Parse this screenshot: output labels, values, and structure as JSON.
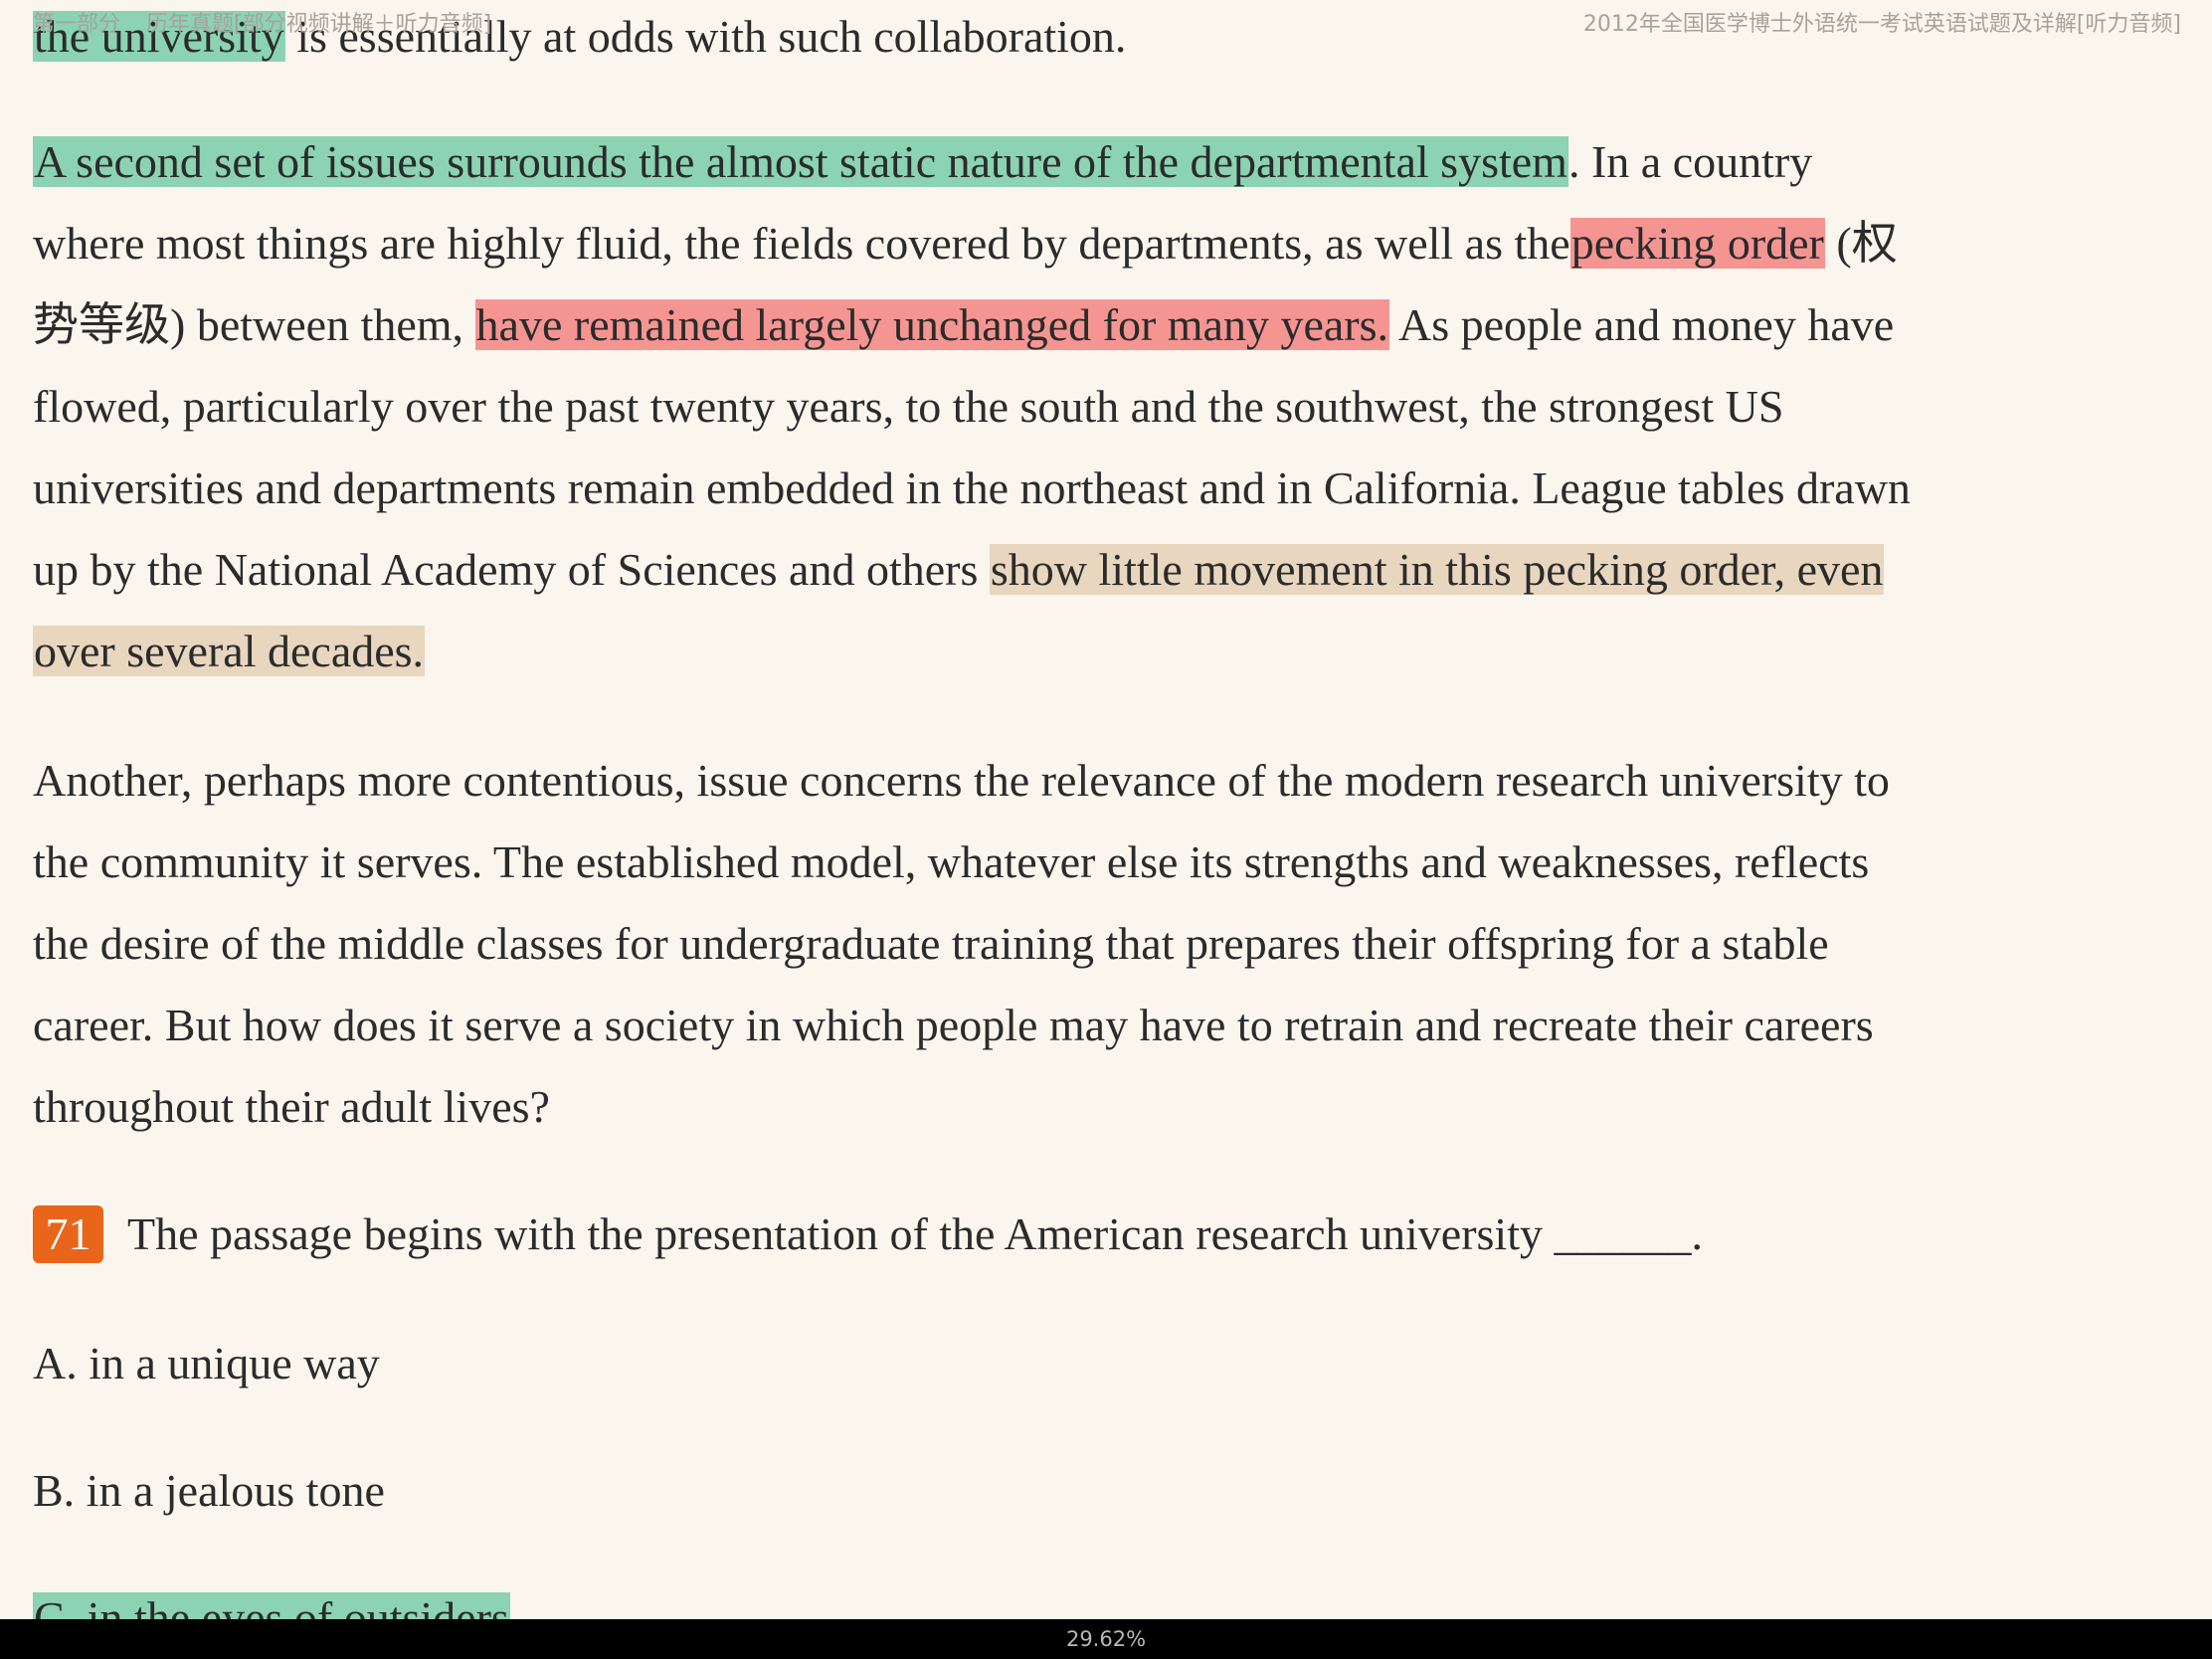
{
  "header": {
    "section": "第一部分",
    "chapter": "历年真题[部分视频讲解＋听力音频]",
    "book_title": "2012年全国医学博士外语统一考试英语试题及详解[听力音频]"
  },
  "passage": {
    "line_top_hl": "the university",
    "line_top_rest": " is essentially at odds with such collaboration.",
    "p1_l1_hl": "A second set of issues surrounds the almost static nature of the departmental system",
    "p1_l1_rest": ". In a country",
    "p1_l2_a": "where most things are highly fluid, the fields covered by departments, as well as the",
    "p1_l2_hl": "pecking order",
    "p1_l2_b": " (权",
    "p1_l3_a": "势等级) between them, ",
    "p1_l3_hl": "have remained largely unchanged for many years.",
    "p1_l3_b": " As people and money have",
    "p1_l4": "flowed, particularly over the past twenty years, to the south and the southwest, the strongest US",
    "p1_l5": "universities and departments remain embedded in the northeast and in California. League tables drawn",
    "p1_l6_a": "up by the National Academy of Sciences and others ",
    "p1_l6_hl": "show little movement in this pecking order, even",
    "p1_l7_hl": "over several decades.",
    "p2_l1": "Another, perhaps more contentious, issue concerns the relevance of the modern research university to",
    "p2_l2": "the community it serves. The established model, whatever else its strengths and weaknesses, reflects",
    "p2_l3": "the desire of the middle classes for undergraduate training that prepares their offspring for a stable",
    "p2_l4": "career. But how does it serve a society in which people may have to retrain and recreate their careers",
    "p2_l5": "throughout their adult lives?"
  },
  "question": {
    "number": "71",
    "text": "The passage begins with the presentation of the American research university ______.",
    "options": [
      "A. in a unique way",
      "B. in a jealous tone",
      "C. in the eyes of outsiders"
    ]
  },
  "status": {
    "progress_text": "29.62%",
    "progress": 0.2962
  },
  "colors": {
    "highlight_green": "#8bd3b3",
    "highlight_red": "#f59592",
    "highlight_tan": "#e8d6bf",
    "question_badge": "#e8651a",
    "background": "#faf6ee"
  }
}
